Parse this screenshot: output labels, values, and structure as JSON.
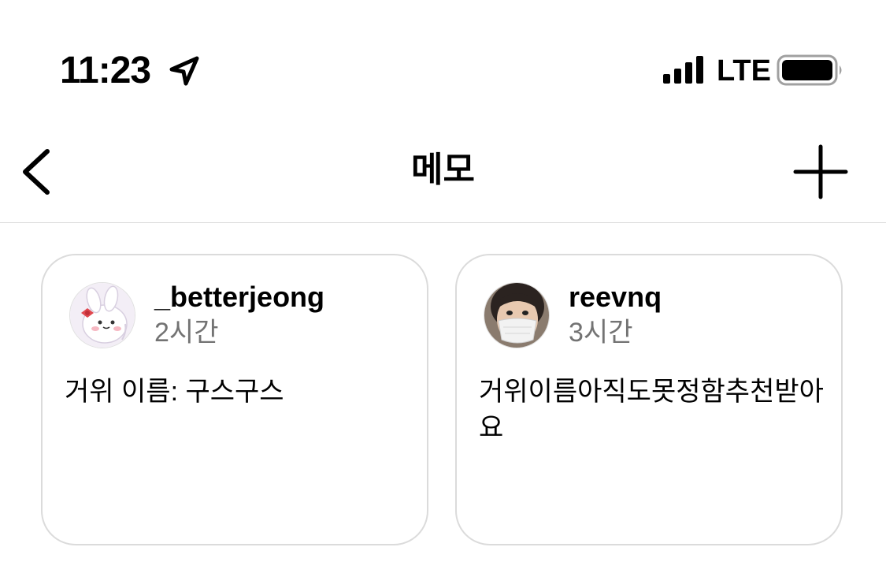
{
  "status_bar": {
    "time": "11:23",
    "network": "LTE",
    "location_icon": "location-arrow-icon",
    "signal_icon": "signal-bars-icon",
    "battery_icon": "battery-icon"
  },
  "nav": {
    "title": "메모",
    "back_icon": "chevron-left-icon",
    "add_icon": "plus-icon"
  },
  "memos": [
    {
      "username": "_betterjeong",
      "time_ago": "2시간",
      "text": "거위 이름: 구스구스"
    },
    {
      "username": "reevnq",
      "time_ago": "3시간",
      "text": "거위이름아직도못정함추천받아요"
    }
  ],
  "colors": {
    "background": "#ffffff",
    "border": "#dbdbdb",
    "secondary_text": "#737373"
  }
}
